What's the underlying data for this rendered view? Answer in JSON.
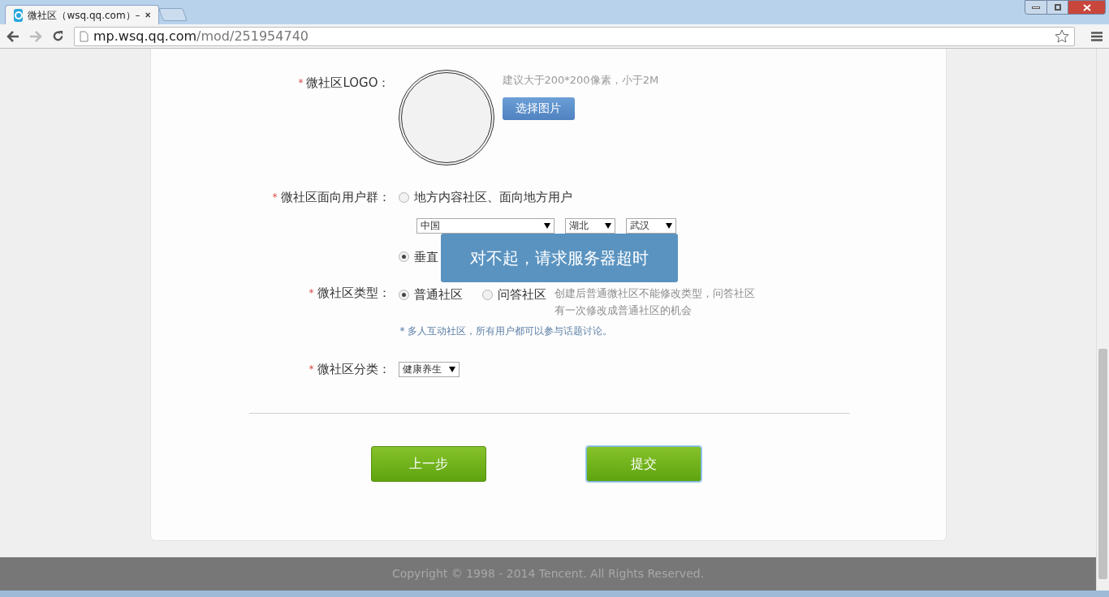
{
  "browser": {
    "tab_title": "微社区（wsq.qq.com）–",
    "url_host": "mp.wsq.qq.com",
    "url_path": "/mod/251954740"
  },
  "form": {
    "logo": {
      "mark": "*",
      "label": "微社区LOGO：",
      "hint": "建议大于200*200像素，小于2M",
      "button": "选择图片"
    },
    "audience": {
      "mark": "*",
      "label": "微社区面向用户群：",
      "options": [
        {
          "label": "地方内容社区、面向地方用户",
          "selected": false,
          "selects": [
            "中国",
            "湖北",
            "武汉"
          ]
        },
        {
          "label": "垂直",
          "selected": true
        }
      ]
    },
    "type": {
      "mark": "*",
      "label": "微社区类型：",
      "options": [
        {
          "label": "普通社区",
          "selected": true
        },
        {
          "label": "问答社区",
          "selected": false
        }
      ],
      "hint_lines": [
        "创建后普通微社区不能修改类型，问答社区",
        "有一次修改成普通社区的机会"
      ],
      "note": "* 多人互动社区，所有用户都可以参与话题讨论。"
    },
    "category": {
      "mark": "*",
      "label": "微社区分类：",
      "value": "健康养生"
    }
  },
  "buttons": [
    {
      "label": "上一步",
      "focused": false
    },
    {
      "label": "提交",
      "focused": true
    }
  ],
  "toast": "对不起，请求服务器超时",
  "footer": "Copyright © 1998 - 2014 Tencent. All Rights Reserved."
}
